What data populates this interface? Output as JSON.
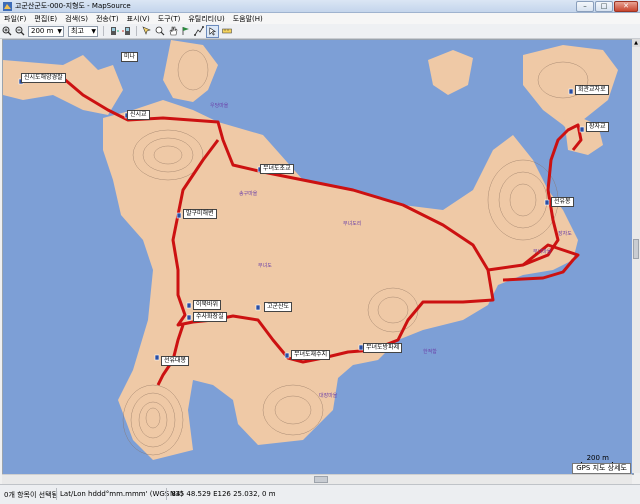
{
  "window": {
    "title": "고군산군도-000-지형도 - MapSource",
    "minimize": "–",
    "maximize": "□",
    "close": "✕"
  },
  "menu": [
    "파일(F)",
    "편집(E)",
    "검색(S)",
    "전송(T)",
    "표시(V)",
    "도구(T)",
    "유틸리티(U)",
    "도움말(H)"
  ],
  "toolbar": {
    "zoom_value": "200 m",
    "detail_value": "최고"
  },
  "map": {
    "colors": {
      "sea": "#7d9fd6",
      "land": "#efc9a6",
      "route": "#cc1111",
      "contour": "#8a6f5c"
    },
    "waypoints": [
      "신시도해양경찰",
      "신시교",
      "무녀도초교",
      "말구미해변",
      "이북바위",
      "수사화장실",
      "무녀도재수지",
      "무녀도방파제",
      "선유대봉",
      "장자교",
      "고군산도",
      "선유봉",
      "회관교차로"
    ],
    "place_texts": [
      "무녀도",
      "무녀도리",
      "장자도",
      "무녀마을",
      "송구마을",
      "우당마을",
      "한적함",
      "대장마을"
    ],
    "top_label": "미나",
    "scale_text": "200 m",
    "gps_text": "GPS 지도 상세도"
  },
  "status": {
    "selection": "0개 항목이 선택됨",
    "format": "Lat/Lon hddd°mm.mmm' (WGS 84)",
    "coords": "N35 48.529 E126 25.032, 0 m"
  }
}
